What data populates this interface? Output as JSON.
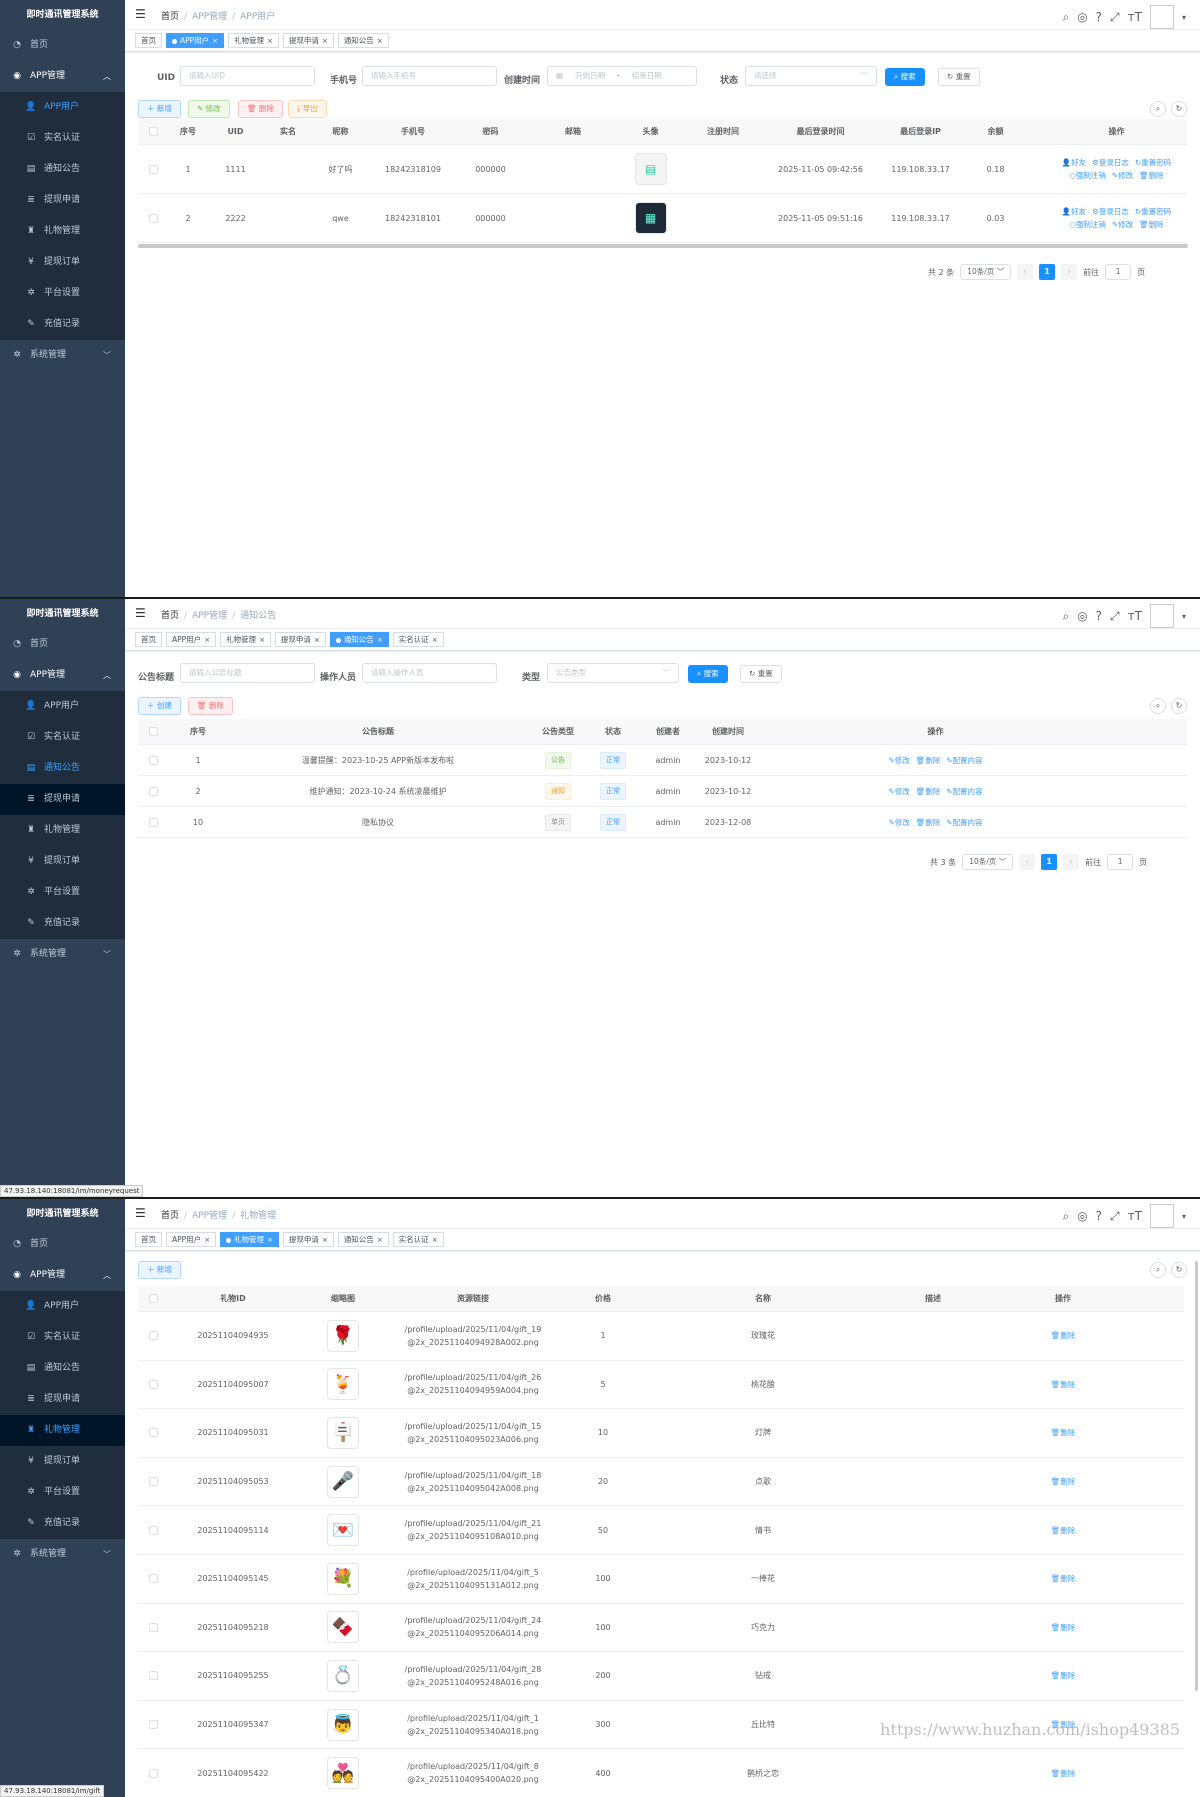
{
  "app_title": "即时通讯管理系统",
  "menu": {
    "home": "首页",
    "app_group": "APP管理",
    "items": [
      "APP用户",
      "实名认证",
      "通知公告",
      "提现申请",
      "礼物管理",
      "提现订单",
      "平台设置",
      "充值记录"
    ],
    "system": "系统管理"
  },
  "crumb_home": "首页",
  "crumb_mid": "APP管理",
  "s1": {
    "crumb_last": "APP用户",
    "tags": [
      "首页",
      "APP用户",
      "礼物管理",
      "提现申请",
      "通知公告"
    ],
    "form": {
      "uid_label": "UID",
      "uid_ph": "请输入UID",
      "phone_label": "手机号",
      "phone_ph": "请输入手机号",
      "time_label": "创建时间",
      "start_ph": "开始日期",
      "sep": "-",
      "end_ph": "结束日期",
      "status_label": "状态",
      "status_ph": "请选择",
      "search": "搜索",
      "reset": "重置"
    },
    "actions": [
      "新增",
      "修改",
      "删除",
      "导出"
    ],
    "columns": [
      "序号",
      "UID",
      "实名",
      "昵称",
      "手机号",
      "密码",
      "邮箱",
      "头像",
      "注册时间",
      "最后登录时间",
      "最后登录IP",
      "余额",
      "操作"
    ],
    "rows": [
      {
        "no": "1",
        "uid": "1111",
        "real": "",
        "nick": "好了吗",
        "phone": "18242318109",
        "pwd": "000000",
        "email": "",
        "reg": "",
        "last": "2025-11-05 09:42:56",
        "ip": "119.108.33.17",
        "bal": "0.18"
      },
      {
        "no": "2",
        "uid": "2222",
        "real": "",
        "nick": "qwe",
        "phone": "18242318101",
        "pwd": "000000",
        "email": "",
        "reg": "",
        "last": "2025-11-05 09:51:16",
        "ip": "119.108.33.17",
        "bal": "0.03"
      }
    ],
    "ops": [
      "好友",
      "登录日志",
      "重置密码",
      "强制注销",
      "修改",
      "删除"
    ],
    "pager": {
      "total": "共 2 条",
      "size": "10条/页",
      "page": "1",
      "goto": "前往",
      "goto_val": "1",
      "unit": "页"
    }
  },
  "s2": {
    "crumb_last": "通知公告",
    "tags": [
      "首页",
      "APP用户",
      "礼物管理",
      "提现申请",
      "通知公告",
      "实名认证"
    ],
    "form": {
      "title_label": "公告标题",
      "title_ph": "请输入公告标题",
      "op_label": "操作人员",
      "op_ph": "请输入操作人员",
      "type_label": "类型",
      "type_ph": "公告类型",
      "search": "搜索",
      "reset": "重置"
    },
    "actions": [
      "创建",
      "删除"
    ],
    "columns": [
      "序号",
      "公告标题",
      "公告类型",
      "状态",
      "创建者",
      "创建时间",
      "操作"
    ],
    "rows": [
      {
        "no": "1",
        "title": "温馨提醒：2023-10-25 APP新版本发布啦",
        "type": "公告",
        "status": "正常",
        "creator": "admin",
        "time": "2023-10-12"
      },
      {
        "no": "2",
        "title": "维护通知：2023-10-24 系统凌晨维护",
        "type": "通知",
        "status": "正常",
        "creator": "admin",
        "time": "2023-10-12"
      },
      {
        "no": "10",
        "title": "隐私协议",
        "type": "单页",
        "status": "正常",
        "creator": "admin",
        "time": "2023-12-08"
      }
    ],
    "ops": [
      "修改",
      "删除",
      "配置内容"
    ],
    "pager": {
      "total": "共 3 条",
      "size": "10条/页",
      "page": "1",
      "goto": "前往",
      "goto_val": "1",
      "unit": "页"
    },
    "status_url": "47.93.18.140:18081/im/moneyrequest"
  },
  "s3": {
    "crumb_last": "礼物管理",
    "tags": [
      "首页",
      "APP用户",
      "礼物管理",
      "提现申请",
      "通知公告",
      "实名认证"
    ],
    "actions": [
      "新增"
    ],
    "columns": [
      "礼物ID",
      "缩略图",
      "资源链接",
      "价格",
      "名称",
      "描述",
      "操作"
    ],
    "rows": [
      {
        "id": "20251104094935",
        "icon": "🌹",
        "l1": "/profile/upload/2025/11/04/gift_19",
        "l2": "@2x_20251104094928A002.png",
        "price": "1",
        "name": "玫瑰花"
      },
      {
        "id": "20251104095007",
        "icon": "🍹",
        "l1": "/profile/upload/2025/11/04/gift_26",
        "l2": "@2x_20251104094959A004.png",
        "price": "5",
        "name": "桃花酿"
      },
      {
        "id": "20251104095031",
        "icon": "🪧",
        "l1": "/profile/upload/2025/11/04/gift_15",
        "l2": "@2x_20251104095023A006.png",
        "price": "10",
        "name": "灯牌"
      },
      {
        "id": "20251104095053",
        "icon": "🎤",
        "l1": "/profile/upload/2025/11/04/gift_18",
        "l2": "@2x_20251104095042A008.png",
        "price": "20",
        "name": "点歌"
      },
      {
        "id": "20251104095114",
        "icon": "💌",
        "l1": "/profile/upload/2025/11/04/gift_21",
        "l2": "@2x_20251104095108A010.png",
        "price": "50",
        "name": "情书"
      },
      {
        "id": "20251104095145",
        "icon": "💐",
        "l1": "/profile/upload/2025/11/04/gift_5",
        "l2": "@2x_20251104095131A012.png",
        "price": "100",
        "name": "一捧花"
      },
      {
        "id": "20251104095218",
        "icon": "🍫",
        "l1": "/profile/upload/2025/11/04/gift_24",
        "l2": "@2x_20251104095206A014.png",
        "price": "100",
        "name": "巧克力"
      },
      {
        "id": "20251104095255",
        "icon": "💍",
        "l1": "/profile/upload/2025/11/04/gift_28",
        "l2": "@2x_20251104095248A016.png",
        "price": "200",
        "name": "钻戒"
      },
      {
        "id": "20251104095347",
        "icon": "👼",
        "l1": "/profile/upload/2025/11/04/gift_1",
        "l2": "@2x_20251104095340A018.png",
        "price": "300",
        "name": "丘比特"
      },
      {
        "id": "20251104095422",
        "icon": "💑",
        "l1": "/profile/upload/2025/11/04/gift_8",
        "l2": "@2x_20251104095400A020.png",
        "price": "400",
        "name": "鹊桥之恋"
      }
    ],
    "op": "删除",
    "watermark": "https://www.huzhan.com/ishop49385",
    "status_url": "47.93.18.140:18081/im/gift"
  }
}
